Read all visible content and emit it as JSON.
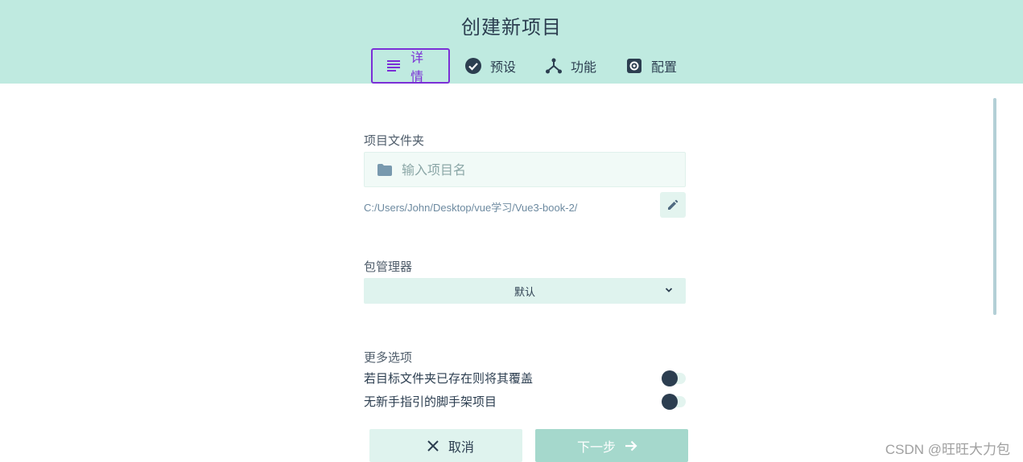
{
  "header": {
    "title": "创建新项目",
    "tabs": [
      {
        "label": "详情",
        "icon": "list-icon",
        "active": true
      },
      {
        "label": "预设",
        "icon": "check-circle-icon",
        "active": false
      },
      {
        "label": "功能",
        "icon": "fork-icon",
        "active": false
      },
      {
        "label": "配置",
        "icon": "gear-icon",
        "active": false
      }
    ]
  },
  "form": {
    "folder_label": "项目文件夹",
    "name_placeholder": "输入项目名",
    "name_value": "",
    "path": "C:/Users/John/Desktop/vue学习/Vue3-book-2/",
    "package_manager_label": "包管理器",
    "package_manager_value": "默认",
    "more_options_label": "更多选项",
    "options": [
      {
        "label": "若目标文件夹已存在则将其覆盖",
        "enabled": false
      },
      {
        "label": "无新手指引的脚手架项目",
        "enabled": false
      }
    ]
  },
  "actions": {
    "cancel_label": "取消",
    "next_label": "下一步"
  },
  "watermark": "CSDN @旺旺大力包",
  "colors": {
    "header_bg": "#bfeae0",
    "accent": "#7b2fd6",
    "primary_text": "#2c3e50",
    "next_button_bg": "#a5d8cc"
  }
}
